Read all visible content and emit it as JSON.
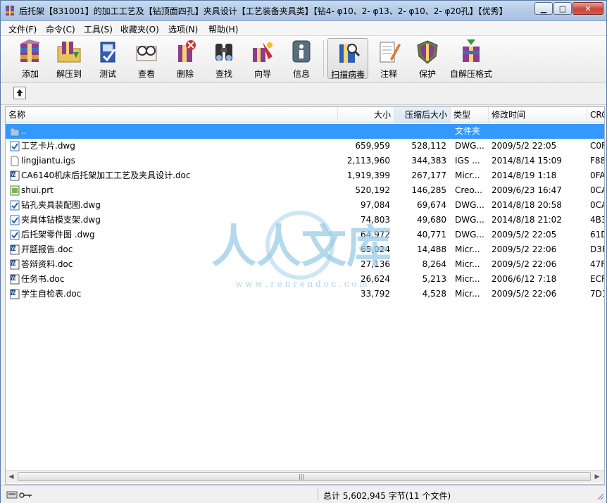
{
  "window": {
    "title": "后托架【831001】的加工工艺及【钻顶面四孔】夹具设计【工艺装备夹具类】【钻4- φ10、2- φ13、2- φ10、2- φ20孔】【优秀】",
    "min_glyph": "▁",
    "max_glyph": "□",
    "close_glyph": "✕"
  },
  "menu": [
    "文件(F)",
    "命令(C)",
    "工具(S)",
    "收藏夹(O)",
    "选项(N)",
    "帮助(H)"
  ],
  "toolbar": [
    {
      "label": "添加",
      "icon": "add-archive-icon"
    },
    {
      "label": "解压到",
      "icon": "extract-to-icon"
    },
    {
      "label": "测试",
      "icon": "test-icon"
    },
    {
      "label": "查看",
      "icon": "view-icon"
    },
    {
      "label": "删除",
      "icon": "delete-icon"
    },
    {
      "label": "查找",
      "icon": "find-icon"
    },
    {
      "label": "向导",
      "icon": "wizard-icon"
    },
    {
      "label": "信息",
      "icon": "info-icon"
    },
    {
      "label": "扫描病毒",
      "icon": "virus-scan-icon"
    },
    {
      "label": "注释",
      "icon": "comment-icon"
    },
    {
      "label": "保护",
      "icon": "protect-icon"
    },
    {
      "label": "自解压格式",
      "icon": "sfx-icon"
    }
  ],
  "columns": {
    "name": "名称",
    "size": "大小",
    "packed": "压缩后大小",
    "type": "类型",
    "modified": "修改时间",
    "crc": "CRC"
  },
  "files": [
    {
      "name": "..",
      "size": "",
      "packed": "",
      "type": "文件夹",
      "modified": "",
      "crc": "",
      "icon": "folder-icon"
    },
    {
      "name": "工艺卡片.dwg",
      "size": "659,959",
      "packed": "528,112",
      "type": "DWG...",
      "modified": "2009/5/2 22:05",
      "crc": "C0F",
      "icon": "dwg-file-icon"
    },
    {
      "name": "lingjiantu.igs",
      "size": "2,113,960",
      "packed": "344,383",
      "type": "IGS ...",
      "modified": "2014/8/14 15:09",
      "crc": "F88",
      "icon": "generic-file-icon"
    },
    {
      "name": "CA6140机床后托架加工工艺及夹具设计.doc",
      "size": "1,919,399",
      "packed": "267,177",
      "type": "Micr...",
      "modified": "2014/8/19 1:18",
      "crc": "0FA",
      "icon": "word-file-icon"
    },
    {
      "name": "shui.prt",
      "size": "520,192",
      "packed": "146,285",
      "type": "Creo...",
      "modified": "2009/6/23 16:47",
      "crc": "0CA",
      "icon": "prt-file-icon"
    },
    {
      "name": "钻孔夹具装配图.dwg",
      "size": "97,084",
      "packed": "69,674",
      "type": "DWG...",
      "modified": "2014/8/18 20:58",
      "crc": "0CA",
      "icon": "dwg-file-icon"
    },
    {
      "name": "夹具体钻模支架.dwg",
      "size": "74,803",
      "packed": "49,680",
      "type": "DWG...",
      "modified": "2014/8/18 21:02",
      "crc": "4B3",
      "icon": "dwg-file-icon"
    },
    {
      "name": "后托架零件图 .dwg",
      "size": "64,972",
      "packed": "40,771",
      "type": "DWG...",
      "modified": "2009/5/2 22:05",
      "crc": "61D",
      "icon": "dwg-file-icon"
    },
    {
      "name": "开题报告.doc",
      "size": "65,024",
      "packed": "14,488",
      "type": "Micr...",
      "modified": "2009/5/2 22:06",
      "crc": "D3F",
      "icon": "word-file-icon"
    },
    {
      "name": "答辩资料.doc",
      "size": "27,136",
      "packed": "8,264",
      "type": "Micr...",
      "modified": "2009/5/2 22:06",
      "crc": "47F",
      "icon": "word-file-icon"
    },
    {
      "name": "任务书.doc",
      "size": "26,624",
      "packed": "5,213",
      "type": "Micr...",
      "modified": "2006/6/12 7:18",
      "crc": "ECF",
      "icon": "word-file-icon"
    },
    {
      "name": "学生自检表.doc",
      "size": "33,792",
      "packed": "4,528",
      "type": "Micr...",
      "modified": "2009/5/2 22:06",
      "crc": "7D1",
      "icon": "word-file-icon"
    }
  ],
  "status": {
    "text": "总计 5,602,945 字节(11 个文件)"
  },
  "watermark": {
    "text": "人人文库",
    "url": "w w w . r e n r e n d o c . c o m"
  },
  "colors": {
    "selection": "#3399ff",
    "title_bar": "#b3cbe6",
    "watermark": "#9ccbe6"
  }
}
